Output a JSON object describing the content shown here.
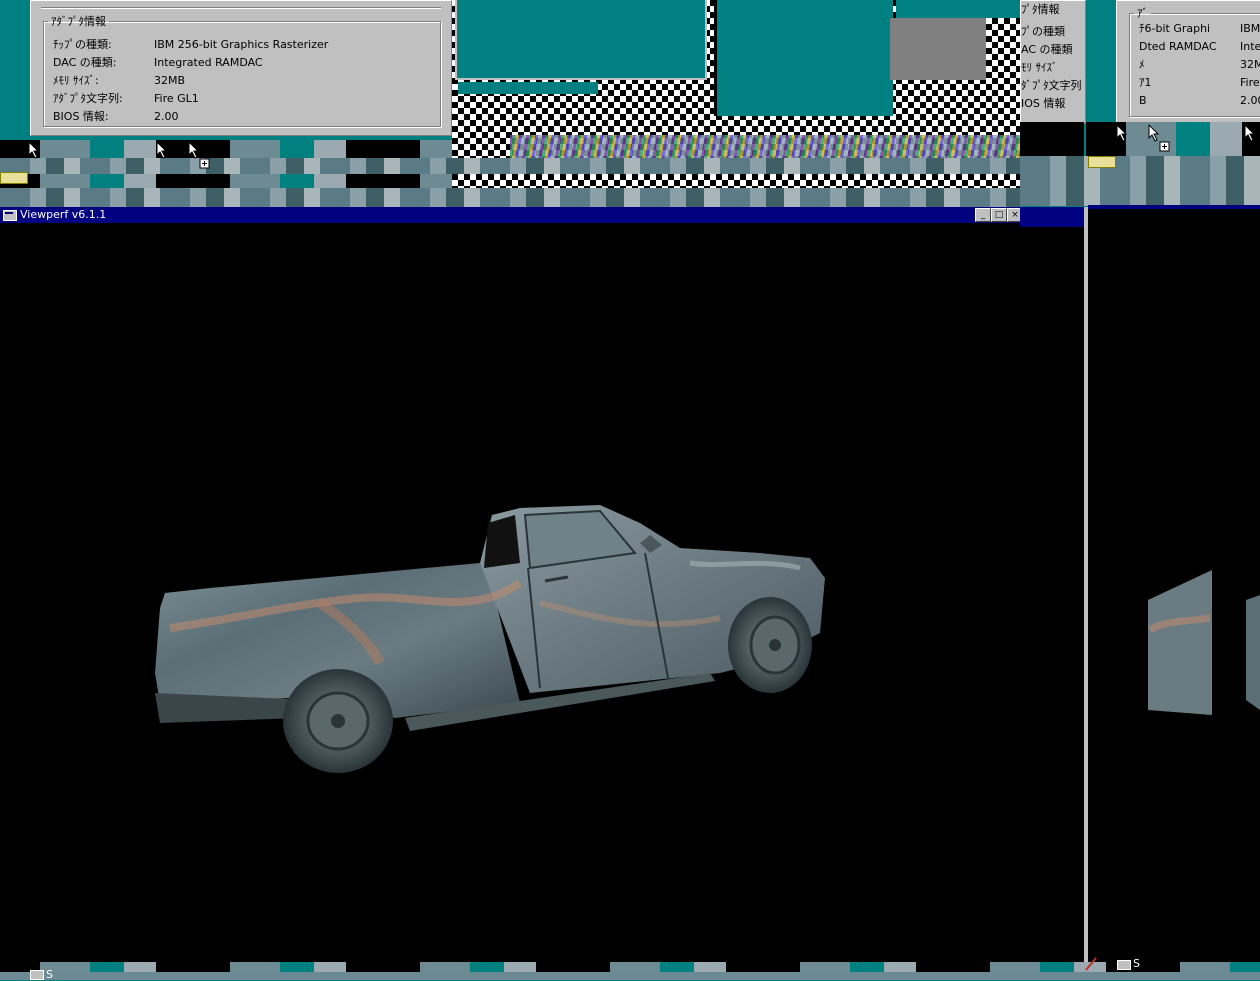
{
  "adapter_panel": {
    "group_title": "ｱﾀﾞﾌﾟﾀ情報",
    "rows": [
      {
        "label": "ﾁｯﾌﾟの種類:",
        "value": "IBM 256-bit Graphics Rasterizer"
      },
      {
        "label": "DAC の種類:",
        "value": "Integrated RAMDAC"
      },
      {
        "label": "ﾒﾓﾘ ｻｲｽﾞ:",
        "value": "32MB"
      },
      {
        "label": "ｱﾀﾞﾌﾟﾀ文字列:",
        "value": "Fire GL1"
      },
      {
        "label": "BIOS 情報:",
        "value": "2.00"
      }
    ]
  },
  "ghost_panel_mid": {
    "group_title": "ﾌﾟﾀ情報",
    "labels": [
      "ﾌﾟの種類",
      "AC の種類",
      "ﾓﾘ ｻｲｽﾞ",
      "ﾀﾞﾌﾟﾀ文字列",
      "IOS 情報"
    ]
  },
  "ghost_panel_right": {
    "group_title": "ｱﾞ",
    "rows": [
      {
        "label": "ﾁ6-bit Graphi",
        "value": "IBM"
      },
      {
        "label": "Dted RAMDAC",
        "value": "Inte"
      },
      {
        "label": "ﾒ",
        "value": "32M"
      },
      {
        "label": "ｱ1",
        "value": "Fire"
      },
      {
        "label": "B",
        "value": "2.00"
      }
    ]
  },
  "viewperf_window": {
    "title": "Viewperf v6.1.1",
    "buttons": {
      "minimize": "_",
      "maximize": "□",
      "close": "×"
    }
  },
  "taskbar_ghost": {
    "label_left": "S",
    "label_right": "S"
  },
  "colors": {
    "desktop": "#008080",
    "titlebar": "#000080",
    "panel": "#c0c0c0",
    "viewport": "#000000",
    "truck_body": "#5f7278"
  }
}
